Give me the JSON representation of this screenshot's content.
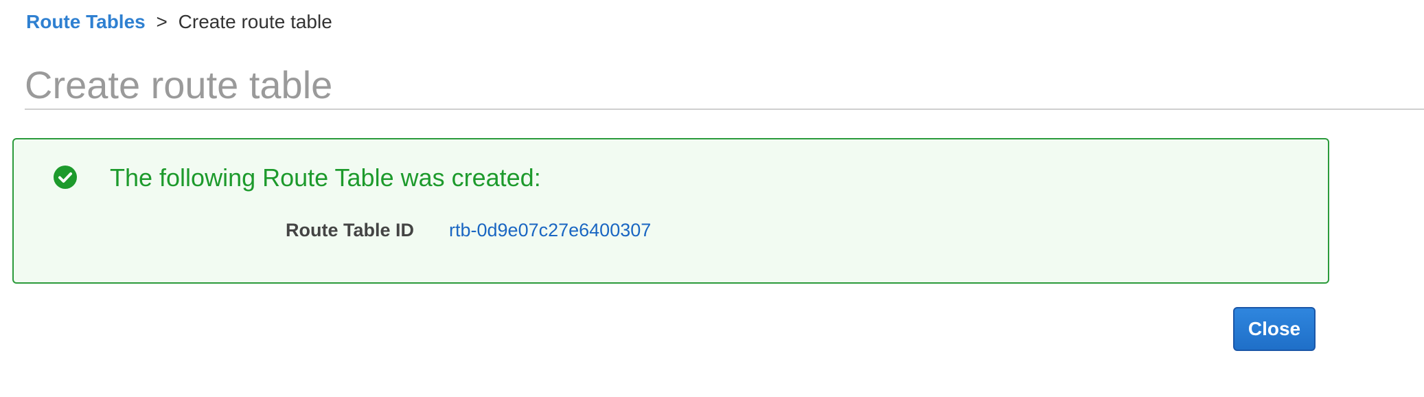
{
  "breadcrumb": {
    "parent_label": "Route Tables",
    "separator": ">",
    "current_label": "Create route table"
  },
  "page": {
    "title": "Create route table"
  },
  "success_panel": {
    "icon": "check-circle-icon",
    "message": "The following Route Table was created:",
    "detail_label": "Route Table ID",
    "detail_value": "rtb-0d9e07c27e6400307",
    "colors": {
      "border": "#2a9a3a",
      "background": "#f2fbf2",
      "message": "#1d9a2c",
      "link": "#1a66c2"
    }
  },
  "actions": {
    "close_label": "Close",
    "close_color": "#1f6fc8"
  }
}
